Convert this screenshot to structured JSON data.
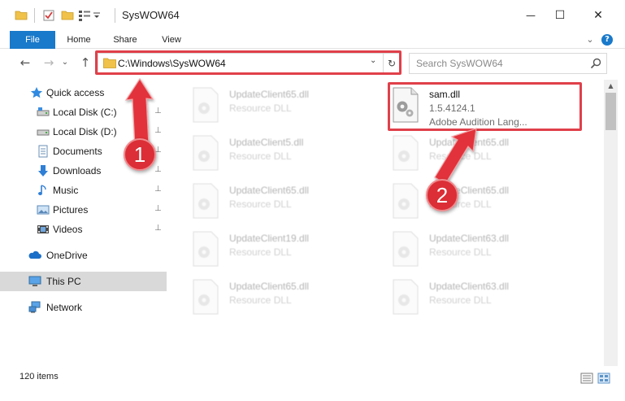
{
  "window": {
    "title": "SysWOW64",
    "minimize_glyph": "—",
    "maximize_glyph": "☐",
    "close_glyph": "✕"
  },
  "ribbon": {
    "tabs": [
      {
        "label": "File",
        "active": true
      },
      {
        "label": "Home",
        "active": false
      },
      {
        "label": "Share",
        "active": false
      },
      {
        "label": "View",
        "active": false
      }
    ],
    "expand_glyph": "⌄",
    "help_glyph": "?"
  },
  "nav": {
    "back_glyph": "←",
    "forward_glyph": "→",
    "recent_glyph": "⌄",
    "up_glyph": "↑",
    "address": "C:\\Windows\\SysWOW64",
    "address_dropdown_glyph": "⌄",
    "refresh_glyph": "↻",
    "search_placeholder": "Search SysWOW64"
  },
  "sidebar": {
    "items": [
      {
        "label": "Quick access",
        "icon": "star-icon",
        "pinned": false,
        "selected": false
      },
      {
        "label": "Local Disk (C:)",
        "icon": "drive-icon",
        "pinned": true,
        "selected": false
      },
      {
        "label": "Local Disk (D:)",
        "icon": "drive-icon",
        "pinned": true,
        "selected": false
      },
      {
        "label": "Documents",
        "icon": "documents-icon",
        "pinned": true,
        "selected": false
      },
      {
        "label": "Downloads",
        "icon": "downloads-icon",
        "pinned": true,
        "selected": false
      },
      {
        "label": "Music",
        "icon": "music-icon",
        "pinned": true,
        "selected": false
      },
      {
        "label": "Pictures",
        "icon": "pictures-icon",
        "pinned": true,
        "selected": false
      },
      {
        "label": "Videos",
        "icon": "videos-icon",
        "pinned": true,
        "selected": false
      },
      {
        "label": "OneDrive",
        "icon": "onedrive-icon",
        "pinned": false,
        "selected": false
      },
      {
        "label": "This PC",
        "icon": "computer-icon",
        "pinned": false,
        "selected": true
      },
      {
        "label": "Network",
        "icon": "network-icon",
        "pinned": false,
        "selected": false
      }
    ],
    "pin_glyph": "📌"
  },
  "files": {
    "left_column": [
      {
        "name": "UpdateClient65.dll",
        "type": "Resource DLL"
      },
      {
        "name": "UpdateClient5.dll",
        "type": "Resource DLL"
      },
      {
        "name": "UpdateClient65.dll",
        "type": "Resource DLL"
      },
      {
        "name": "UpdateClient19.dll",
        "type": "Resource DLL"
      },
      {
        "name": "UpdateClient65.dll",
        "type": "Resource DLL"
      }
    ],
    "right_column": [
      {
        "name": "sam.dll",
        "version": "1.5.4124.1",
        "description": "Adobe Audition Lang..."
      },
      {
        "name": "UpdateClient65.dll",
        "type": "Resource DLL"
      },
      {
        "name": "UpdateClient65.dll",
        "type": "Resource DLL"
      },
      {
        "name": "UpdateClient63.dll",
        "type": "Resource DLL"
      },
      {
        "name": "UpdateClient63.dll",
        "type": "Resource DLL"
      }
    ]
  },
  "status": {
    "item_count": "120 items"
  },
  "annotations": {
    "step1": "1",
    "step2": "2",
    "highlight_color": "#e0404a",
    "badge_color": "#db2e36"
  },
  "colors": {
    "accent": "#1979ca",
    "selection": "#d9d9d9",
    "folder": "#f0c24a"
  }
}
